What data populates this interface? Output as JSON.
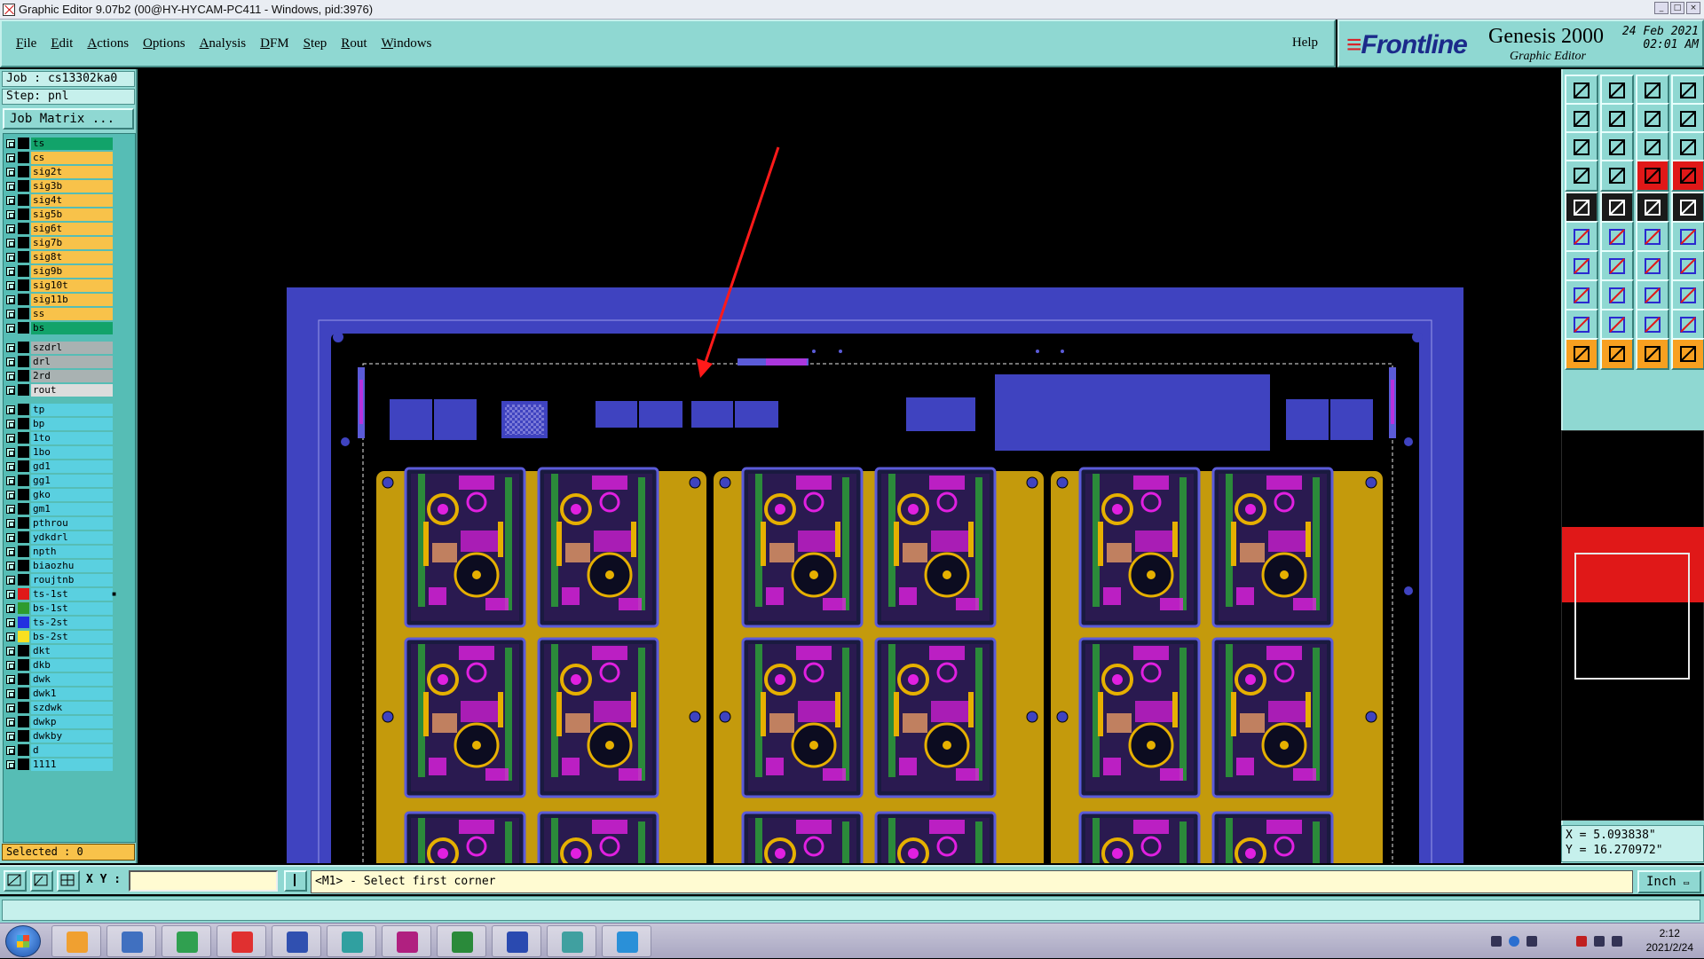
{
  "window": {
    "title": "Graphic Editor 9.07b2 (00@HY-HYCAM-PC411 - Windows, pid:3976)"
  },
  "menu": {
    "items": [
      "File",
      "Edit",
      "Actions",
      "Options",
      "Analysis",
      "DFM",
      "Step",
      "Rout",
      "Windows"
    ],
    "help": "Help"
  },
  "brand": {
    "logo": "Frontline",
    "product": "Genesis 2000",
    "subtitle": "Graphic Editor",
    "date": "24 Feb 2021",
    "time": "02:01 AM"
  },
  "job": {
    "job_line": "Job : cs13302ka0",
    "step_line": "Step: pnl",
    "matrix_button": "Job Matrix ..."
  },
  "layers": [
    {
      "name": "ts",
      "color": "#12a36a"
    },
    {
      "name": "cs",
      "color": "#f8c24a"
    },
    {
      "name": "sig2t",
      "color": "#f8c24a"
    },
    {
      "name": "sig3b",
      "color": "#f8c24a"
    },
    {
      "name": "sig4t",
      "color": "#f8c24a"
    },
    {
      "name": "sig5b",
      "color": "#f8c24a"
    },
    {
      "name": "sig6t",
      "color": "#f8c24a"
    },
    {
      "name": "sig7b",
      "color": "#f8c24a"
    },
    {
      "name": "sig8t",
      "color": "#f8c24a"
    },
    {
      "name": "sig9b",
      "color": "#f8c24a"
    },
    {
      "name": "sig10t",
      "color": "#f8c24a"
    },
    {
      "name": "sig11b",
      "color": "#f8c24a"
    },
    {
      "name": "ss",
      "color": "#f8c24a"
    },
    {
      "name": "bs",
      "color": "#12a36a"
    },
    {
      "name": "szdrl",
      "color": "#a9b2b2"
    },
    {
      "name": "drl",
      "color": "#a9b2b2"
    },
    {
      "name": "2rd",
      "color": "#a9b2b2"
    },
    {
      "name": "rout",
      "color": "#dcdcdc"
    },
    {
      "name": "tp",
      "color": "#5ad0e0"
    },
    {
      "name": "bp",
      "color": "#5ad0e0"
    },
    {
      "name": "1to",
      "color": "#5ad0e0"
    },
    {
      "name": "1bo",
      "color": "#5ad0e0"
    },
    {
      "name": "gd1",
      "color": "#5ad0e0"
    },
    {
      "name": "gg1",
      "color": "#5ad0e0"
    },
    {
      "name": "gko",
      "color": "#5ad0e0"
    },
    {
      "name": "gm1",
      "color": "#5ad0e0"
    },
    {
      "name": "pthrou",
      "color": "#5ad0e0"
    },
    {
      "name": "ydkdrl",
      "color": "#5ad0e0"
    },
    {
      "name": "npth",
      "color": "#5ad0e0"
    },
    {
      "name": "biaozhu",
      "color": "#5ad0e0"
    },
    {
      "name": "roujtnb",
      "color": "#5ad0e0"
    },
    {
      "name": "ts-1st",
      "color": "#5ad0e0",
      "swatch": "#e01818"
    },
    {
      "name": "bs-1st",
      "color": "#5ad0e0",
      "swatch": "#2e9b2e"
    },
    {
      "name": "ts-2st",
      "color": "#5ad0e0",
      "swatch": "#2230e0"
    },
    {
      "name": "bs-2st",
      "color": "#5ad0e0",
      "swatch": "#f8e020"
    },
    {
      "name": "dkt",
      "color": "#5ad0e0"
    },
    {
      "name": "dkb",
      "color": "#5ad0e0"
    },
    {
      "name": "dwk",
      "color": "#5ad0e0"
    },
    {
      "name": "dwk1",
      "color": "#5ad0e0"
    },
    {
      "name": "szdwk",
      "color": "#5ad0e0"
    },
    {
      "name": "dwkp",
      "color": "#5ad0e0"
    },
    {
      "name": "dwkby",
      "color": "#5ad0e0"
    },
    {
      "name": "d",
      "color": "#5ad0e0"
    },
    {
      "name": "1111",
      "color": "#5ad0e0"
    }
  ],
  "selected": "Selected : 0",
  "coords": {
    "x": "X = 5.093838\"",
    "y": "Y = 16.270972\""
  },
  "command": {
    "xy_label": "X Y :",
    "xy_value": "",
    "prompt": "<M1> - Select first corner",
    "units": "Inch"
  },
  "taskbar": {
    "time": "2:12",
    "date": "2021/2/24"
  },
  "colors": {
    "panel": "#8fd8d2",
    "panel_blue": "#3f43c0",
    "copper": "#c49a0c",
    "magenta": "#e020e0",
    "annotation_arrow": "#ff1a1a"
  }
}
